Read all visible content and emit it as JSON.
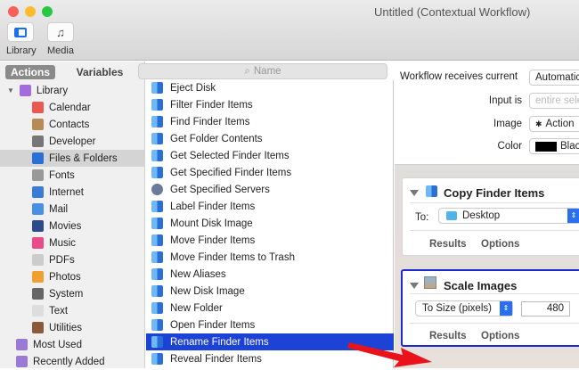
{
  "window": {
    "title": "Untitled (Contextual Workflow)"
  },
  "toolbar": {
    "library_label": "Library",
    "media_label": "Media"
  },
  "library_tabs": {
    "actions": "Actions",
    "variables": "Variables"
  },
  "search": {
    "placeholder": "Name"
  },
  "sidebar": {
    "items": [
      {
        "label": "Library",
        "icon": "library-icon",
        "color": "#a36be0"
      },
      {
        "label": "Calendar",
        "icon": "calendar-icon",
        "color": "#e85a4f"
      },
      {
        "label": "Contacts",
        "icon": "contacts-icon",
        "color": "#b88a55"
      },
      {
        "label": "Developer",
        "icon": "developer-icon",
        "color": "#777777"
      },
      {
        "label": "Files & Folders",
        "icon": "finder-icon",
        "color": "#2a6fd6"
      },
      {
        "label": "Fonts",
        "icon": "fonts-icon",
        "color": "#999999"
      },
      {
        "label": "Internet",
        "icon": "internet-icon",
        "color": "#3a7bd5"
      },
      {
        "label": "Mail",
        "icon": "mail-icon",
        "color": "#4a90e2"
      },
      {
        "label": "Movies",
        "icon": "movies-icon",
        "color": "#2d4a8a"
      },
      {
        "label": "Music",
        "icon": "music-icon",
        "color": "#e84a8a"
      },
      {
        "label": "PDFs",
        "icon": "pdf-icon",
        "color": "#cccccc"
      },
      {
        "label": "Photos",
        "icon": "photos-icon",
        "color": "#f0a030"
      },
      {
        "label": "System",
        "icon": "system-icon",
        "color": "#666666"
      },
      {
        "label": "Text",
        "icon": "text-icon",
        "color": "#dddddd"
      },
      {
        "label": "Utilities",
        "icon": "utilities-icon",
        "color": "#8a5a3a"
      },
      {
        "label": "Most Used",
        "icon": "smart-folder-icon",
        "color": "#9b7ad6"
      },
      {
        "label": "Recently Added",
        "icon": "smart-folder-icon",
        "color": "#9b7ad6"
      }
    ],
    "selected": "Files & Folders"
  },
  "actions": {
    "items": [
      "Eject Disk",
      "Filter Finder Items",
      "Find Finder Items",
      "Get Folder Contents",
      "Get Selected Finder Items",
      "Get Specified Finder Items",
      "Get Specified Servers",
      "Label Finder Items",
      "Mount Disk Image",
      "Move Finder Items",
      "Move Finder Items to Trash",
      "New Aliases",
      "New Disk Image",
      "New Folder",
      "Open Finder Items",
      "Rename Finder Items",
      "Reveal Finder Items"
    ],
    "selected": "Rename Finder Items"
  },
  "workflow": {
    "receives_label": "Workflow receives current",
    "receives_value": "Automatic",
    "input_label": "Input is",
    "input_value": "entire selection",
    "image_label": "Image",
    "image_value": "Action",
    "color_label": "Color",
    "color_value": "Black"
  },
  "cards": [
    {
      "title": "Copy Finder Items",
      "to_label": "To:",
      "to_value": "Desktop",
      "results": "Results",
      "options": "Options"
    },
    {
      "title": "Scale Images",
      "mode": "To Size (pixels)",
      "size": "480",
      "results": "Results",
      "options": "Options"
    }
  ],
  "colors": {
    "selection": "#1d42d6",
    "arrow": "#e8131b"
  }
}
